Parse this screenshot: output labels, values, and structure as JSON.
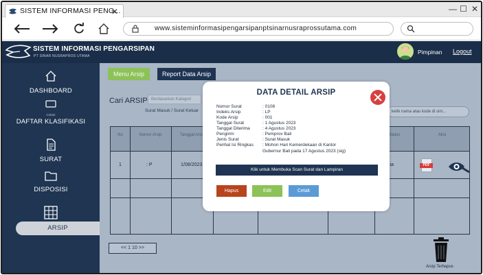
{
  "browser": {
    "tab_title": "SISTEM INFORMASI PENG...",
    "url": "www.sisteminformasipengarsipanptsinarnusraprossutama.com"
  },
  "header": {
    "app_title": "SISTEM INFORMASI PENGARSIPAN",
    "app_subtitle": "PT SINAR NUSRAPROS UTAMA",
    "user_name": "Pimpinan",
    "logout_label": "Logout"
  },
  "sidebar": {
    "items": [
      {
        "label": "DASHBOARD",
        "icon": "home-icon"
      },
      {
        "label": "DAFTAR KLASIFIKASI",
        "sublabel": "CODE",
        "icon": "code-icon"
      },
      {
        "label": "SURAT",
        "icon": "document-icon"
      },
      {
        "label": "DISPOSISI",
        "icon": "folder-icon"
      },
      {
        "label": "ARSIP",
        "icon": "archive-icon"
      }
    ],
    "active": "ARSIP"
  },
  "main": {
    "menu_arsip_label": "Menu Arsip",
    "report_label": "Report Data Arsip",
    "cari_label": "Cari ARSIP :",
    "filter_placeholder": "Berdasarkan Kategori",
    "tab_surat": "Surat Masuk / Surat Keluar",
    "search_placeholder": "ketik nama atau kode di sini...",
    "table": {
      "headers": [
        "No",
        "Nomor Arsip",
        "Tanggal Arsip",
        "",
        "",
        "",
        "Status",
        "Aksi"
      ],
      "rows": [
        {
          "no": "1",
          "kode": ": P",
          "tanggal": "1/08/2023",
          "status": "Terima"
        }
      ]
    },
    "pager_label": "<< 1 10 >>",
    "trash_label": "Arsip Terhapus"
  },
  "modal": {
    "title": "DATA DETAIL ARSIP",
    "fields": [
      {
        "key": "Nomor Surat",
        "value": ": 0108"
      },
      {
        "key": "Indeks Arsip",
        "value": ": LP"
      },
      {
        "key": "Kode Arsip",
        "value": ": 001"
      },
      {
        "key": "Tanggal Surat",
        "value": ": 1 Agustus 2023"
      },
      {
        "key": "Tanggal Diterima",
        "value": ": 4 Agustus 2023"
      },
      {
        "key": "Pengirim",
        "value": ": Pemprov Bali"
      },
      {
        "key": "Jenis Surat",
        "value": ": Surat Masuk"
      },
      {
        "key": "Perihal Isi Ringkas",
        "value": ": Mohon Hari Kemerdekaan di Kantor"
      },
      {
        "key": "",
        "value": "Gubernur Bali pada 17 Agustus 2023 (sig)"
      }
    ],
    "scan_button": "Klik untuk Membuka Scan Surat dan Lampiran",
    "delete_button": "Hapus",
    "edit_button": "Edit",
    "print_button": "Cetak"
  },
  "colors": {
    "header_bg": "#1a2e4a",
    "sidebar_bg": "#1f3552",
    "main_bg": "#a9b6c6",
    "accent_green": "#8cc257",
    "danger_red": "#d84040",
    "print_blue": "#5b9bd5"
  }
}
